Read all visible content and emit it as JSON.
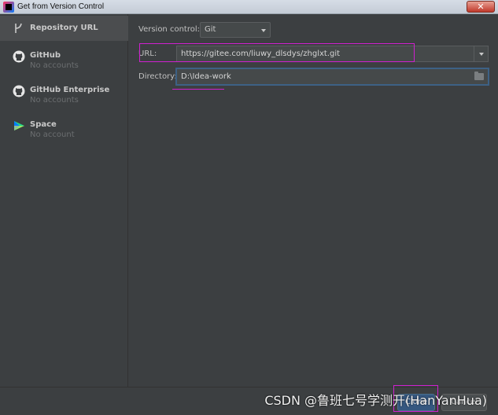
{
  "window": {
    "title": "Get from Version Control",
    "close_label": "✕"
  },
  "sidebar": {
    "items": [
      {
        "label": "Repository URL",
        "sub": ""
      },
      {
        "label": "GitHub",
        "sub": "No accounts"
      },
      {
        "label": "GitHub Enterprise",
        "sub": "No accounts"
      },
      {
        "label": "Space",
        "sub": "No account"
      }
    ]
  },
  "form": {
    "version_control_label": "Version control:",
    "version_control_value": "Git",
    "url_label": "URL:",
    "url_value": "https://gitee.com/liuwy_dlsdys/zhglxt.git",
    "directory_label": "Directory:",
    "directory_value": "D:\\Idea-work"
  },
  "footer": {
    "clone_label": "Clone",
    "cancel_label": "Cancel",
    "watermark": "CSDN @鲁班七号学测开(HanYanHua)"
  },
  "colors": {
    "accent": "#365880",
    "annotation": "#d020d0"
  }
}
